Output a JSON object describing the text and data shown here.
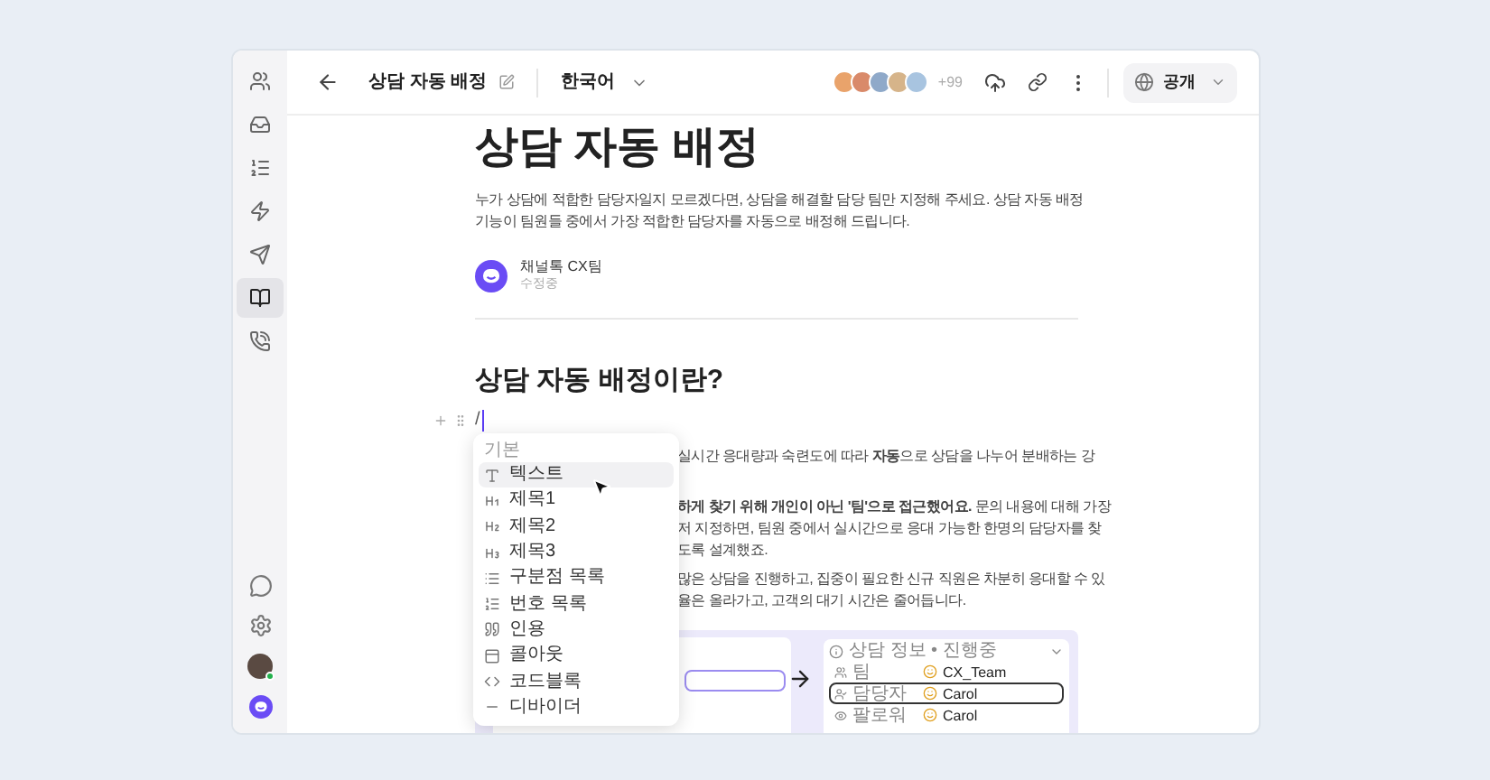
{
  "sidebar": {
    "items": [
      {
        "selected": false
      },
      {
        "selected": false
      },
      {
        "selected": false
      },
      {
        "selected": false
      },
      {
        "selected": false
      },
      {
        "selected": true
      },
      {
        "selected": false
      }
    ],
    "user": {
      "online": true
    }
  },
  "topbar": {
    "title": "상담 자동 배정",
    "language": "한국어",
    "viewer_count": "+99",
    "visibility": "공개"
  },
  "document": {
    "title": "상담 자동 배정",
    "description": "누가 상담에 적합한 담당자일지 모르겠다면, 상담을 해결할 담당 팀만 지정해 주세요. 상담 자동 배정 기능이 팀원들 중에서 가장 적합한 담당자를 자동으로 배정해 드립니다.",
    "author": {
      "name": "채널톡 CX팀",
      "status": "수정중"
    },
    "heading": "상담 자동 배정이란?",
    "input": "/",
    "paragraphs": [
      [
        "실시간 응대량과 숙련도에 따라 **자동**으로 상담을 나누어 분배하는 강"
      ],
      [
        "**하게 찾기 위해 개인이 아닌 '팀'으로 접근했어요.** 문의 내용에 대해 가장",
        "저 지정하면, 팀원 중에서 실시간으로 응대 가능한 한명의 담당자를 찾",
        "도록 설계했죠."
      ],
      [
        "많은 상담을 진행하고, 집중이 필요한 신규 직원은 차분히 응대할 수 있",
        "율은 올라가고, 고객의 대기 시간은 줄어듭니다."
      ]
    ]
  },
  "block_menu": {
    "section": "기본",
    "items": [
      {
        "label": "텍스트",
        "kind": "text",
        "selected": true
      },
      {
        "label": "제목1",
        "kind": "h1",
        "selected": false
      },
      {
        "label": "제목2",
        "kind": "h2",
        "selected": false
      },
      {
        "label": "제목3",
        "kind": "h3",
        "selected": false
      },
      {
        "label": "구분점 목록",
        "kind": "bullet",
        "selected": false
      },
      {
        "label": "번호 목록",
        "kind": "numbered",
        "selected": false
      },
      {
        "label": "인용",
        "kind": "quote",
        "selected": false
      },
      {
        "label": "콜아웃",
        "kind": "callout",
        "selected": false
      },
      {
        "label": "코드블록",
        "kind": "code",
        "selected": false
      },
      {
        "label": "디바이더",
        "kind": "divider",
        "selected": false
      }
    ]
  },
  "illustration": {
    "panel_title": "상담 정보 • 진행중",
    "rows": [
      {
        "label": "팀",
        "value": "CX_Team",
        "selected": false
      },
      {
        "label": "담당자",
        "value": "Carol",
        "selected": true
      },
      {
        "label": "팔로워",
        "value": "Carol",
        "selected": false
      }
    ]
  }
}
